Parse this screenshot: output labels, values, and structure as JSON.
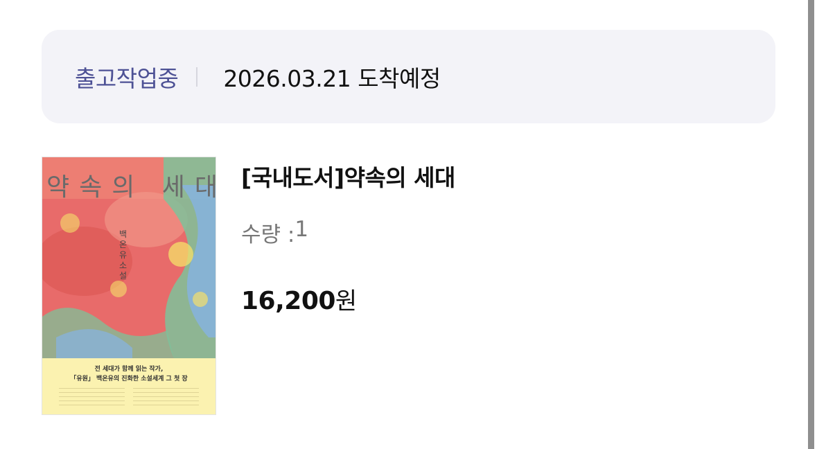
{
  "order_status": {
    "status_label": "출고작업중",
    "arrival_text": "2026.03.21 도착예정"
  },
  "product": {
    "title": "[국내도서]약속의 세대",
    "quantity_label": "수량 : ",
    "quantity": "1",
    "price": "16,200",
    "currency": "원",
    "cover": {
      "title": "약속의 세대",
      "author_line": "백온유 소설",
      "band_line_1": "전 세대가 함께 읽는 작가,",
      "band_line_2": "「유원」 백온유의 진화한 소설세계 그 첫 장",
      "colors": {
        "main": "#e86b6a",
        "green": "#7ec29a",
        "blue": "#86b3e4",
        "yellow": "#f5e06a",
        "band": "#fbf2b0"
      }
    }
  }
}
